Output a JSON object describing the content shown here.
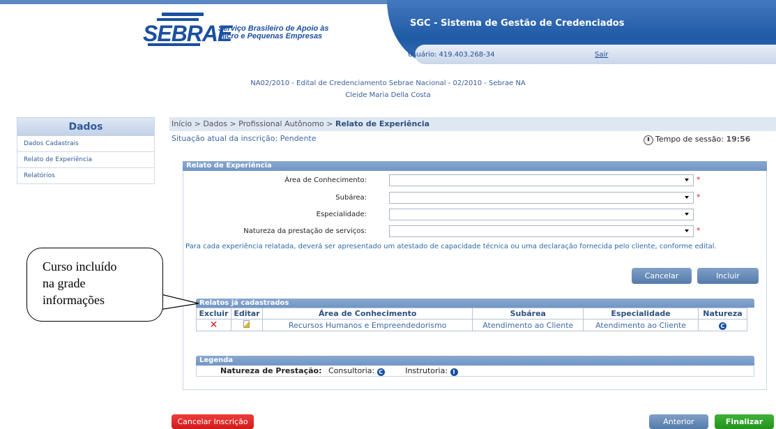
{
  "header": {
    "brand": "SEBRAE",
    "brand_sub_line1": "Serviço Brasileiro de Apoio às",
    "brand_sub_line2": "Micro e Pequenas Empresas",
    "system_title": "SGC - Sistema de Gestão de Credenciados",
    "user": "Usuário: 419.403.268-34",
    "logout": "Sair"
  },
  "edital": {
    "line1": "NA02/2010 - Edital de Credenciamento Sebrae Nacional - 02/2010 - Sebrae NA",
    "line2": "Cleide Maria Della Costa"
  },
  "sidebar": {
    "title": "Dados",
    "items": [
      {
        "label": "Dados Cadastrais"
      },
      {
        "label": "Relato de Experiência"
      },
      {
        "label": "Relatórios"
      }
    ]
  },
  "breadcrumb": {
    "path": "Início > Dados > Profissional Autônomo > ",
    "current": "Relato de Experiência"
  },
  "status": {
    "situacao": "Situação atual da inscrição: Pendente",
    "session_label": "Tempo de sessão: ",
    "session_time": "19:56"
  },
  "form": {
    "title": "Relato de Experiência",
    "fields": [
      {
        "label": "Área de Conhecimento:",
        "value": "",
        "required": "*"
      },
      {
        "label": "Subárea:",
        "value": "",
        "required": "*"
      },
      {
        "label": "Especialidade:",
        "value": "",
        "required": ""
      },
      {
        "label": "Natureza da prestação de serviços:",
        "value": "",
        "required": "*"
      }
    ],
    "note": "Para cada experiência relatada, deverá ser apresentado um atestado de capacidade técnica ou uma declaração fornecida pelo cliente, conforme edital.",
    "cancel_label": "Cancelar",
    "add_label": "Incluir"
  },
  "relatos": {
    "title": "Relatos já cadastrados",
    "columns": [
      "Excluir",
      "Editar",
      "Área de Conhecimento",
      "Subárea",
      "Especialidade",
      "Natureza"
    ],
    "rows": [
      {
        "area": "Recursos Humanos e Empreendedorismo",
        "subarea": "Atendimento ao Cliente",
        "especialidade": "Atendimento ao Cliente",
        "natureza": "C"
      }
    ]
  },
  "legenda": {
    "title": "Legenda",
    "label": "Natureza de Prestação:",
    "consultoria": "Consultoria:",
    "consultoria_icon": "C",
    "instrutoria": "Instrutoria:",
    "instrutoria_icon": "I"
  },
  "callout": {
    "text_line1": "Curso incluído",
    "text_line2": "na grade",
    "text_line3": "informações"
  },
  "footer": {
    "cancel_inscricao": "Cancelar Inscrição",
    "anterior": "Anterior",
    "finalizar": "Finalizar"
  },
  "colors": {
    "brand_blue": "#1b4fa0",
    "header_blue": "#1f5aa5",
    "danger": "#d11b1b",
    "success": "#23921e"
  }
}
